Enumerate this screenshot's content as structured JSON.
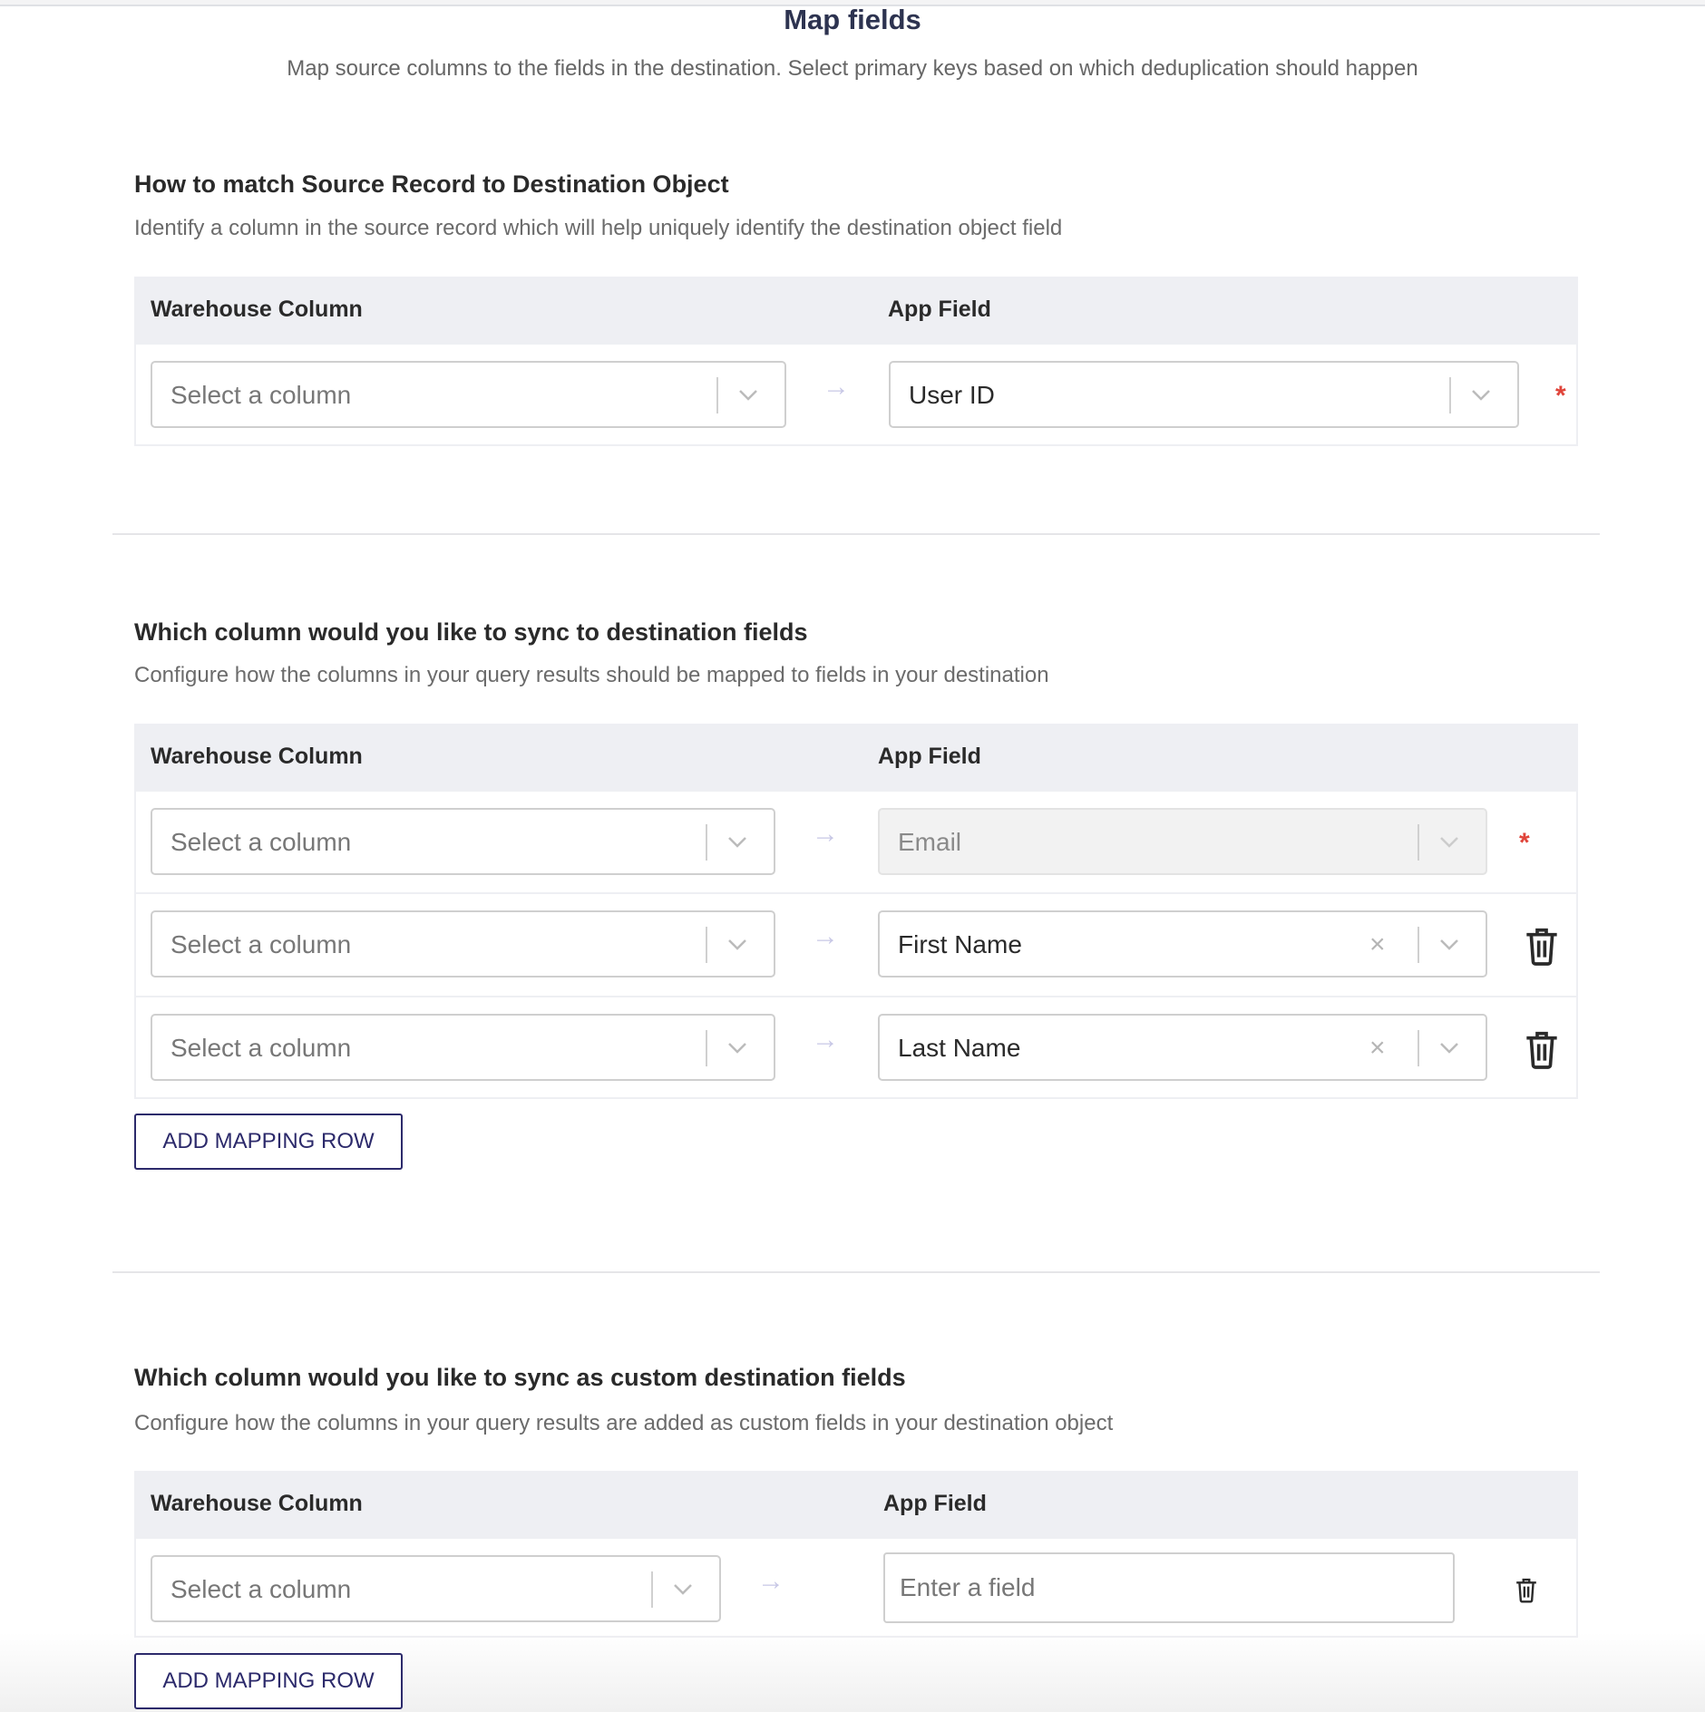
{
  "header": {
    "title": "Map fields",
    "subtitle": "Map source columns to the fields in the destination. Select primary keys based on which deduplication should happen"
  },
  "columns": {
    "warehouse": "Warehouse Column",
    "app": "App Field"
  },
  "placeholder_column": "Select a column",
  "section1": {
    "title": "How to match Source Record to Destination Object",
    "description": "Identify a column in the source record which will help uniquely identify the destination object field",
    "rows": [
      {
        "app_field": "User ID",
        "required": "*"
      }
    ]
  },
  "section2": {
    "title": "Which column would you like to sync to destination fields",
    "description": "Configure how the columns in your query results should be mapped to fields in your destination",
    "rows": [
      {
        "app_field": "Email",
        "required": "*",
        "disabled": true
      },
      {
        "app_field": "First Name"
      },
      {
        "app_field": "Last Name"
      }
    ],
    "add_button": "ADD MAPPING ROW"
  },
  "section3": {
    "title": "Which column would you like to sync as custom destination fields",
    "description": "Configure how the columns in your query results are added as custom fields in your destination object",
    "field_placeholder": "Enter a field",
    "add_button": "ADD MAPPING ROW"
  },
  "icons": {
    "arrow": "→",
    "clear": "×"
  }
}
